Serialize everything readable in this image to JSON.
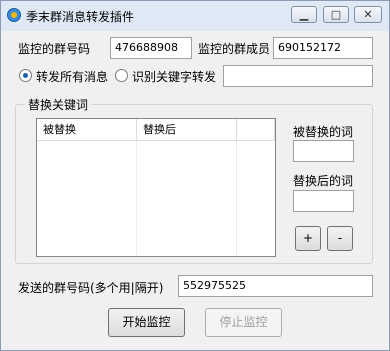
{
  "window": {
    "title": "季末群消息转发插件",
    "controls": {
      "minimize": "▁",
      "maximize": "□",
      "close": "✕"
    }
  },
  "monitor": {
    "group_label": "监控的群号码",
    "group_value": "476688908",
    "member_label": "监控的群成员",
    "member_value": "690152172"
  },
  "mode": {
    "option1": "转发所有消息",
    "option2": "识别关键字转发",
    "selected": "option1",
    "keyword_value": ""
  },
  "replace": {
    "group_title": "替换关键词",
    "columns": [
      "被替换",
      "替换后"
    ],
    "rows": [],
    "replaced_label": "被替换的词",
    "replaced_value": "",
    "after_label": "替换后的词",
    "after_value": "",
    "add_label": "+",
    "remove_label": "-"
  },
  "send": {
    "label": "发送的群号码(多个用|隔开)",
    "value": "552975525"
  },
  "actions": {
    "start_label": "开始监控",
    "stop_label": "停止监控"
  }
}
